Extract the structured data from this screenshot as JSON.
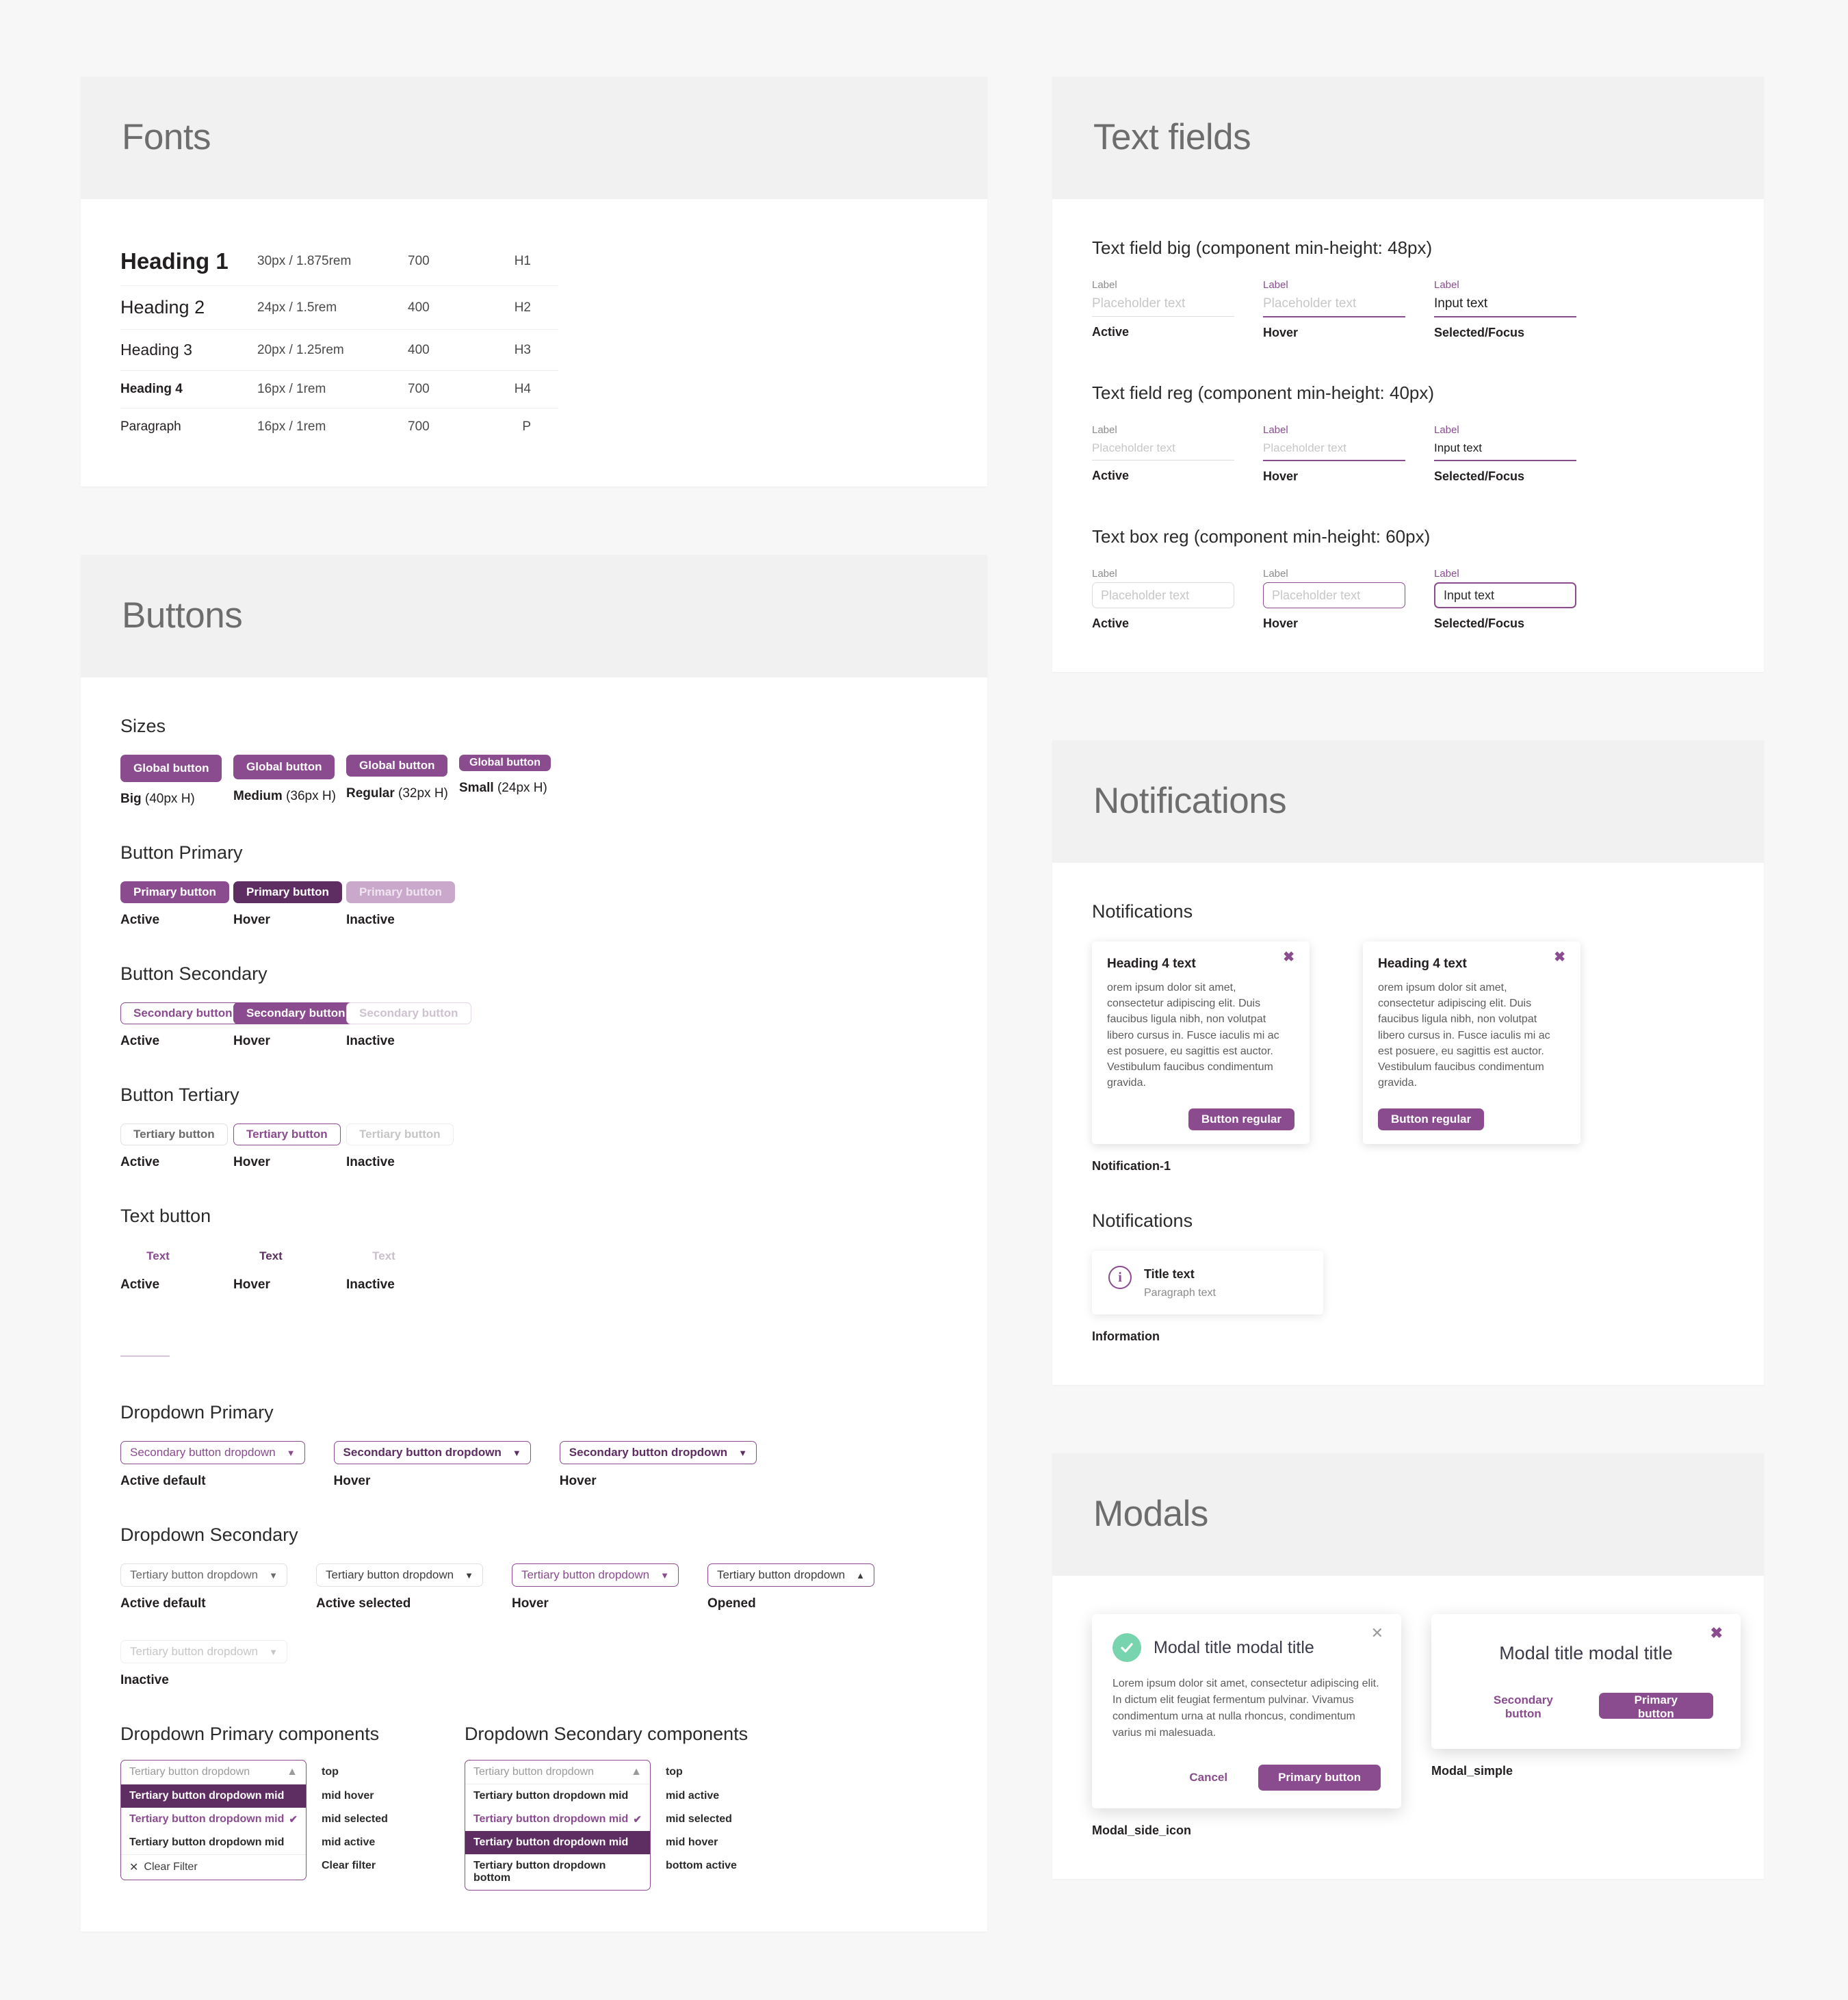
{
  "fonts": {
    "section_title": "Fonts",
    "rows": [
      {
        "name": "Heading 1",
        "size": "30px / 1.875rem",
        "weight": "700",
        "tag": "H1"
      },
      {
        "name": "Heading 2",
        "size": "24px / 1.5rem",
        "weight": "400",
        "tag": "H2"
      },
      {
        "name": "Heading 3",
        "size": "20px / 1.25rem",
        "weight": "400",
        "tag": "H3"
      },
      {
        "name": "Heading 4",
        "size": "16px / 1rem",
        "weight": "700",
        "tag": "H4"
      },
      {
        "name": "Paragraph",
        "size": "16px / 1rem",
        "weight": "700",
        "tag": "P"
      }
    ]
  },
  "buttons": {
    "section_title": "Buttons",
    "sizes": {
      "heading": "Sizes",
      "items": [
        {
          "label": "Global button",
          "caption_bold": "Big",
          "caption_rest": " (40px H)"
        },
        {
          "label": "Global button",
          "caption_bold": "Medium",
          "caption_rest": " (36px H)"
        },
        {
          "label": "Global button",
          "caption_bold": "Regular",
          "caption_rest": " (32px H)"
        },
        {
          "label": "Global button",
          "caption_bold": "Small",
          "caption_rest": " (24px H)"
        }
      ]
    },
    "primary": {
      "heading": "Button Primary",
      "label": "Primary button",
      "states": [
        "Active",
        "Hover",
        "Inactive"
      ]
    },
    "secondary": {
      "heading": "Button Secondary",
      "label": "Secondary button",
      "states": [
        "Active",
        "Hover",
        "Inactive"
      ]
    },
    "tertiary": {
      "heading": "Button Tertiary",
      "label": "Tertiary button",
      "states": [
        "Active",
        "Hover",
        "Inactive"
      ]
    },
    "text": {
      "heading": "Text button",
      "label": "Text",
      "states": [
        "Active",
        "Hover",
        "Inactive"
      ]
    },
    "dropdown_primary": {
      "heading": "Dropdown Primary",
      "label": "Secondary button dropdown",
      "states": [
        "Active default",
        "Hover",
        "Hover"
      ]
    },
    "dropdown_secondary": {
      "heading": "Dropdown Secondary",
      "label": "Tertiary button dropdown",
      "states": [
        "Active default",
        "Active selected",
        "Hover",
        "Opened",
        "Inactive"
      ]
    },
    "dropdown_primary_components": {
      "heading": "Dropdown Primary components",
      "top_label": "Tertiary button dropdown",
      "items": [
        {
          "label": "Tertiary button dropdown mid",
          "state": "mid hover"
        },
        {
          "label": "Tertiary button dropdown mid",
          "state": "mid selected"
        },
        {
          "label": "Tertiary button dropdown mid",
          "state": "mid active"
        }
      ],
      "clear_label": "Clear Filter",
      "clear_state": "Clear filter",
      "top_state": "top"
    },
    "dropdown_secondary_components": {
      "heading": "Dropdown Secondary components",
      "top_label": "Tertiary button dropdown",
      "top_state": "top",
      "items": [
        {
          "label": "Tertiary button dropdown mid",
          "state": "mid active"
        },
        {
          "label": "Tertiary button dropdown mid",
          "state": "mid selected"
        },
        {
          "label": "Tertiary button dropdown mid",
          "state": "mid hover"
        },
        {
          "label": "Tertiary button dropdown bottom",
          "state": "bottom active"
        }
      ]
    }
  },
  "text_fields": {
    "section_title": "Text fields",
    "groups": [
      {
        "title": "Text field big (component min-height: 48px)",
        "fields": [
          {
            "label": "Label",
            "placeholder": "Placeholder text",
            "value": "",
            "state": "Active"
          },
          {
            "label": "Label",
            "placeholder": "Placeholder text",
            "value": "",
            "state": "Hover"
          },
          {
            "label": "Label",
            "placeholder": "",
            "value": "Input text",
            "state": "Selected/Focus"
          }
        ]
      },
      {
        "title": "Text field reg (component min-height: 40px)",
        "fields": [
          {
            "label": "Label",
            "placeholder": "Placeholder text",
            "value": "",
            "state": "Active"
          },
          {
            "label": "Label",
            "placeholder": "Placeholder text",
            "value": "",
            "state": "Hover"
          },
          {
            "label": "Label",
            "placeholder": "",
            "value": "Input text",
            "state": "Selected/Focus"
          }
        ]
      },
      {
        "title": "Text box reg (component min-height: 60px)",
        "fields": [
          {
            "label": "Label",
            "placeholder": "Placeholder text",
            "value": "",
            "state": "Active"
          },
          {
            "label": "Label",
            "placeholder": "Placeholder text",
            "value": "",
            "state": "Hover"
          },
          {
            "label": "Label",
            "placeholder": "",
            "value": "Input text",
            "state": "Selected/Focus"
          }
        ]
      }
    ]
  },
  "notifications": {
    "section_title": "Notifications",
    "group1_heading": "Notifications",
    "group2_heading": "Notifications",
    "card": {
      "title": "Heading 4 text",
      "body": "orem ipsum dolor sit amet, consectetur adipiscing elit. Duis faucibus ligula nibh, non volutpat libero cursus in. Fusce iaculis mi ac est posuere, eu sagittis est auctor. Vestibulum faucibus condimentum gravida.",
      "button": "Button regular",
      "close": "✖"
    },
    "caption1": "Notification-1",
    "info": {
      "icon": "i",
      "title": "Title text",
      "paragraph": "Paragraph text",
      "caption": "Information"
    }
  },
  "modals": {
    "section_title": "Modals",
    "side_icon": {
      "title": "Modal title modal title",
      "body": "Lorem ipsum dolor sit amet, consectetur adipiscing elit. In dictum elit feugiat fermentum pulvinar. Vivamus condimentum urna at nulla rhoncus, condimentum varius mi malesuada.",
      "cancel": "Cancel",
      "primary": "Primary button",
      "close": "✕",
      "caption": "Modal_side_icon"
    },
    "simple": {
      "title": "Modal title modal title",
      "secondary": "Secondary button",
      "primary": "Primary button",
      "close": "✖",
      "caption": "Modal_simple"
    }
  }
}
